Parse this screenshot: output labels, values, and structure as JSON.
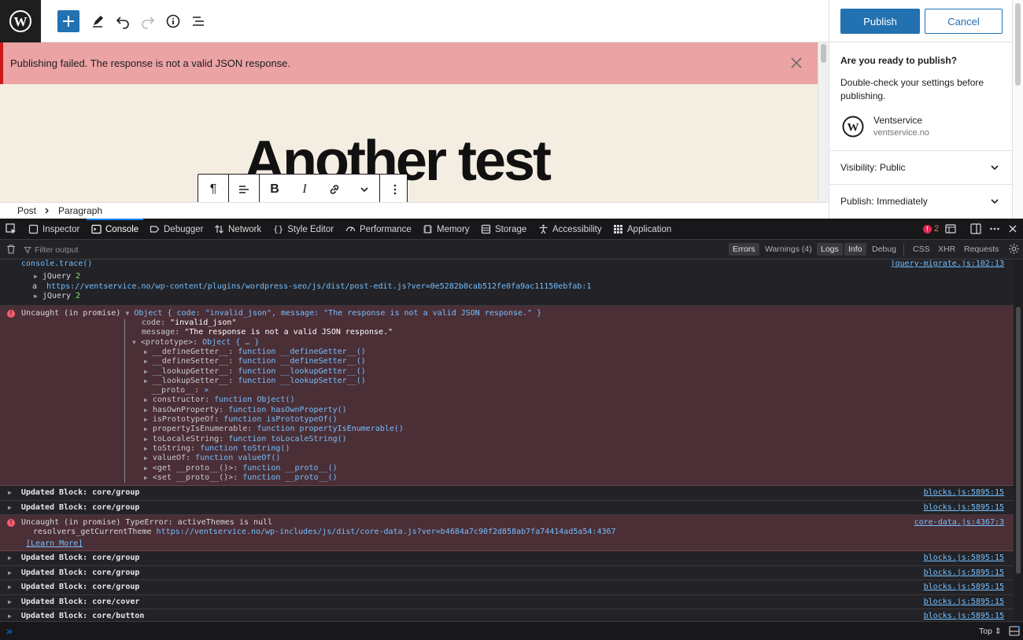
{
  "editor": {
    "notice": "Publishing failed. The response is not a valid JSON response.",
    "post_title": "Another test",
    "breadcrumb": [
      "Post",
      "Paragraph"
    ]
  },
  "sidebar": {
    "publish_label": "Publish",
    "cancel_label": "Cancel",
    "ready_title": "Are you ready to publish?",
    "ready_desc": "Double-check your settings before publishing.",
    "site_name": "Ventservice",
    "site_url": "ventservice.no",
    "visibility_label": "Visibility:",
    "visibility_value": "Public",
    "publish_label_row": "Publish:",
    "publish_value": "Immediately"
  },
  "devtools": {
    "tabs": [
      "Inspector",
      "Console",
      "Debugger",
      "Network",
      "Style Editor",
      "Performance",
      "Memory",
      "Storage",
      "Accessibility",
      "Application"
    ],
    "active_tab": "Console",
    "error_count": "2",
    "filter_placeholder": "Filter output",
    "filters": [
      "Errors",
      "Warnings (4)",
      "Logs",
      "Info",
      "Debug"
    ],
    "filter_types": [
      "CSS",
      "XHR",
      "Requests"
    ],
    "bottom_select": "Top",
    "colors": {
      "accent": "#0a84ff",
      "error_bg": "#4b2f36",
      "link": "#75bfff"
    }
  },
  "console": {
    "trace": {
      "l1": "console.trace()",
      "l2": "jQuery",
      "l2n": "2",
      "l3a": "a",
      "l3": "https://ventservice.no/wp-content/plugins/wordpress-seo/js/dist/post-edit.js?ver=0e5282b0cab512fe0fa9ac11150ebfab:1",
      "l4": "jQuery",
      "l4n": "2",
      "src": "jquery-migrate.js:102:13"
    },
    "error1": {
      "head": "Uncaught (in promise)",
      "obj": "Object { code: \"invalid_json\", message: \"The response is not a valid JSON response.\" }",
      "lines": [
        [
          "code: ",
          "\"invalid_json\""
        ],
        [
          "message: ",
          "\"The response is not a valid JSON response.\""
        ],
        [
          "<prototype>: ",
          "Object { … }"
        ],
        [
          "__defineGetter__: ",
          "function __defineGetter__()"
        ],
        [
          "__defineSetter__: ",
          "function __defineSetter__()"
        ],
        [
          "__lookupGetter__: ",
          "function __lookupGetter__()"
        ],
        [
          "__lookupSetter__: ",
          "function __lookupSetter__()"
        ],
        [
          "__proto__: ",
          "»"
        ],
        [
          "constructor: ",
          "function Object()"
        ],
        [
          "hasOwnProperty: ",
          "function hasOwnProperty()"
        ],
        [
          "isPrototypeOf: ",
          "function isPrototypeOf()"
        ],
        [
          "propertyIsEnumerable: ",
          "function propertyIsEnumerable()"
        ],
        [
          "toLocaleString: ",
          "function toLocaleString()"
        ],
        [
          "toString: ",
          "function toString()"
        ],
        [
          "valueOf: ",
          "function valueOf()"
        ],
        [
          "<get __proto__()>: ",
          "function __proto__()"
        ],
        [
          "<set __proto__()>: ",
          "function __proto__()"
        ]
      ]
    },
    "updates_a": [
      {
        "text": "Updated Block: core/group",
        "src": "blocks.js:5895:15"
      },
      {
        "text": "Updated Block: core/group",
        "src": "blocks.js:5895:15"
      }
    ],
    "error2": {
      "line1": "Uncaught (in promise) TypeError: activeThemes is null",
      "line2a": "resolvers_getCurrentTheme",
      "line2b": "https://ventservice.no/wp-includes/js/dist/core-data.js?ver=b4684a7c90f2d858ab7fa74414ad5a54:4367",
      "learn": "[Learn More]",
      "src": "core-data.js:4367:3"
    },
    "updates_b": [
      {
        "text": "Updated Block: core/group",
        "src": "blocks.js:5895:15"
      },
      {
        "text": "Updated Block: core/group",
        "src": "blocks.js:5895:15"
      },
      {
        "text": "Updated Block: core/group",
        "src": "blocks.js:5895:15"
      },
      {
        "text": "Updated Block: core/cover",
        "src": "blocks.js:5895:15"
      },
      {
        "text": "Updated Block: core/button",
        "src": "blocks.js:5895:15"
      }
    ]
  }
}
